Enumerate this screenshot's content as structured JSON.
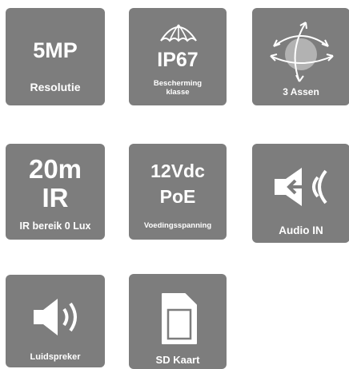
{
  "tiles": {
    "resolution": {
      "big": "5MP",
      "label": "Resolutie"
    },
    "ip": {
      "big": "IP67",
      "label_line1": "Bescherming",
      "label_line2": "klasse"
    },
    "axes": {
      "label": "3 Assen"
    },
    "ir": {
      "big_line1": "20m",
      "big_line2": "IR",
      "label": "IR bereik 0 Lux"
    },
    "power": {
      "big_line1": "12Vdc",
      "big_line2": "PoE",
      "label": "Voedingsspanning"
    },
    "audio_in": {
      "label": "Audio IN"
    },
    "speaker": {
      "label": "Luidspreker"
    },
    "sd": {
      "label": "SD Kaart"
    }
  },
  "colors": {
    "tile": "#7d7d7d",
    "text": "#ffffff",
    "background": "#ffffff"
  }
}
